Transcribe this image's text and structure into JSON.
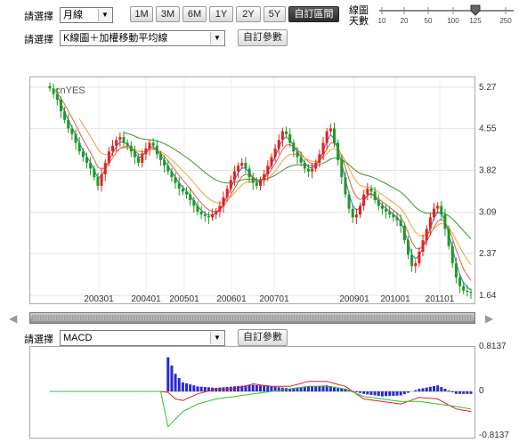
{
  "controls": {
    "period_label": "請選擇",
    "period_value": "月線",
    "range_buttons": [
      "1M",
      "3M",
      "6M",
      "1Y",
      "2Y",
      "5Y",
      "自訂區間"
    ],
    "range_active_index": 6,
    "days_label_1": "線圖",
    "days_label_2": "天數",
    "days_ticks": [
      "10",
      "20",
      "50",
      "100",
      "125",
      "250"
    ],
    "days_value": 125,
    "chart_type_label": "請選擇",
    "chart_type_value": "K線圖＋加權移動平均線",
    "custom_button": "自訂參數",
    "indicator_label": "請選擇",
    "indicator_value": "MACD",
    "indicator_button": "自訂參數"
  },
  "colors": {
    "up": "#e8201c",
    "down": "#1f9a1f",
    "ma_short": "#3a6fd8",
    "ma_mid": "#e85a4a",
    "ma_long": "#f0a030",
    "ma_longest": "#2e9a2e",
    "hist": "#2a2ad0",
    "macd_line": "#e02020",
    "signal_line": "#2ec02e"
  },
  "chart_data": [
    {
      "type": "candlestick",
      "watermark": "cnYES",
      "x_tick_labels": [
        "200301",
        "200401",
        "200501",
        "200601",
        "200701",
        "200901",
        "201001",
        "201101"
      ],
      "y_tick_labels": [
        "5.27",
        "4.55",
        "3.82",
        "3.09",
        "2.37",
        "1.64"
      ],
      "ylim": [
        1.64,
        5.27
      ],
      "grid": true,
      "closes": [
        5.25,
        5.15,
        5.05,
        4.85,
        4.7,
        4.55,
        4.45,
        4.3,
        4.15,
        4.05,
        3.95,
        3.85,
        3.7,
        3.55,
        3.75,
        3.95,
        4.15,
        4.25,
        4.35,
        4.4,
        4.3,
        4.25,
        4.15,
        4.05,
        3.95,
        4.1,
        4.2,
        4.3,
        4.25,
        4.1,
        4.0,
        3.9,
        3.8,
        3.7,
        3.6,
        3.5,
        3.45,
        3.4,
        3.3,
        3.2,
        3.1,
        3.05,
        3.02,
        3.0,
        3.05,
        3.1,
        3.2,
        3.35,
        3.5,
        3.65,
        3.8,
        3.9,
        3.95,
        3.85,
        3.7,
        3.6,
        3.55,
        3.65,
        3.75,
        3.9,
        4.05,
        4.2,
        4.35,
        4.5,
        4.45,
        4.3,
        4.15,
        4.05,
        3.95,
        3.85,
        3.8,
        3.85,
        3.95,
        4.1,
        4.3,
        4.5,
        4.55,
        4.3,
        4.0,
        3.7,
        3.4,
        3.15,
        3.0,
        3.05,
        3.2,
        3.4,
        3.5,
        3.45,
        3.3,
        3.2,
        3.15,
        3.1,
        3.05,
        3.0,
        2.95,
        2.85,
        2.6,
        2.35,
        2.15,
        2.2,
        2.4,
        2.6,
        2.8,
        3.0,
        3.15,
        3.2,
        3.05,
        2.8,
        2.5,
        2.2,
        1.95,
        1.8,
        1.72,
        1.7,
        1.68
      ]
    },
    {
      "type": "bar+line",
      "title": "MACD",
      "y_tick_labels": [
        "0.8137",
        "0",
        "-0.8137"
      ],
      "ylim": [
        -0.8137,
        0.8137
      ],
      "x": [
        0,
        20,
        30,
        32,
        34,
        36,
        40,
        45,
        50,
        55,
        60,
        65,
        70,
        75,
        80,
        85,
        90,
        95,
        100,
        105,
        110,
        114
      ],
      "series": [
        {
          "values": [
            0,
            0,
            0,
            0.68,
            0.35,
            0.18,
            0.1,
            0.07,
            0.1,
            0.13,
            0.1,
            0.06,
            0.1,
            0.12,
            0.05,
            -0.05,
            -0.1,
            -0.08,
            0.05,
            0.12,
            -0.05,
            -0.05
          ]
        },
        {
          "values": [
            0,
            0,
            0,
            -0.02,
            -0.15,
            -0.18,
            -0.05,
            0.05,
            0.05,
            0.15,
            0.1,
            0.1,
            0.2,
            0.2,
            0.1,
            -0.15,
            -0.2,
            -0.25,
            -0.12,
            -0.15,
            -0.35,
            -0.4
          ]
        },
        {
          "values": [
            0,
            0,
            0,
            -0.7,
            -0.55,
            -0.4,
            -0.25,
            -0.15,
            -0.1,
            -0.05,
            0.0,
            0.05,
            0.1,
            0.1,
            0.05,
            -0.1,
            -0.15,
            -0.2,
            -0.2,
            -0.25,
            -0.3,
            -0.35
          ]
        }
      ]
    }
  ]
}
